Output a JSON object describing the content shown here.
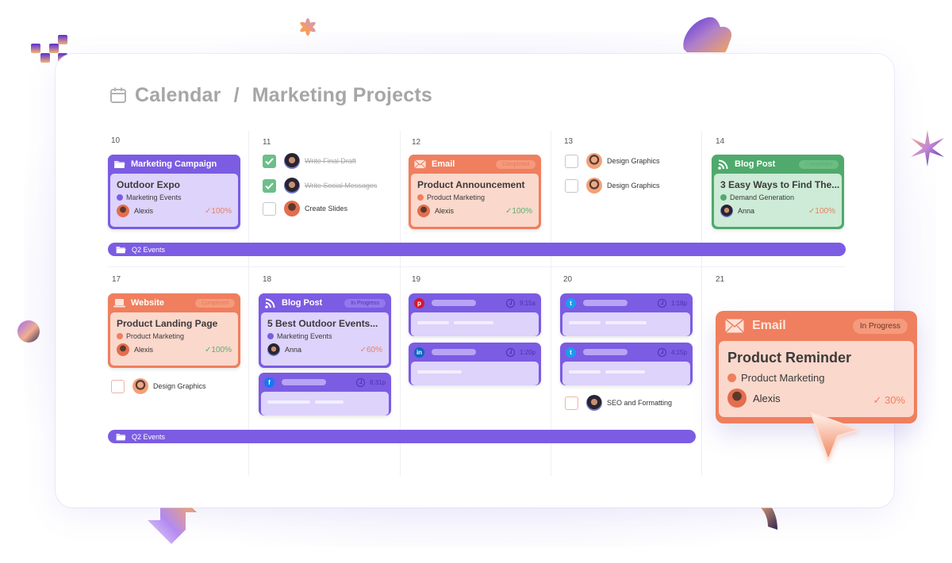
{
  "header": {
    "icon": "calendar-icon",
    "crumb1": "Calendar",
    "separator": "/",
    "crumb2": "Marketing Projects"
  },
  "days": {
    "d10": "10",
    "d11": "11",
    "d12": "12",
    "d13": "13",
    "d14": "14",
    "d17": "17",
    "d18": "18",
    "d19": "19",
    "d20": "20",
    "d21": "21"
  },
  "cards": {
    "outdoor_expo": {
      "type_label": "Marketing Campaign",
      "type_icon": "folder-icon",
      "title": "Outdoor Expo",
      "tag": "Marketing Events",
      "assignee": "Alexis",
      "progress": "100%",
      "color": "#7b5ce3"
    },
    "product_announcement": {
      "type_label": "Email",
      "type_icon": "envelope-icon",
      "status": "Completed",
      "title": "Product Announcement",
      "tag": "Product Marketing",
      "assignee": "Alexis",
      "progress": "100%",
      "color": "#ef7f5e"
    },
    "easy_ways": {
      "type_label": "Blog Post",
      "type_icon": "rss-icon",
      "status": "Completed",
      "title": "3 Easy Ways to Find The...",
      "tag": "Demand Generation",
      "assignee": "Anna",
      "progress": "100%",
      "color": "#4faa6c"
    },
    "landing_page": {
      "type_label": "Website",
      "type_icon": "laptop-icon",
      "status": "Completed",
      "title": "Product Landing Page",
      "tag": "Product Marketing",
      "assignee": "Alexis",
      "progress": "100%",
      "color": "#ef7f5e"
    },
    "outdoor_events": {
      "type_label": "Blog Post",
      "type_icon": "rss-icon",
      "status": "In Progress",
      "title": "5 Best Outdoor Events...",
      "tag": "Marketing Events",
      "assignee": "Anna",
      "progress": "60%",
      "color": "#7b5ce3"
    }
  },
  "popup": {
    "type_label": "Email",
    "type_icon": "envelope-icon",
    "status": "In Progress",
    "title": "Product Reminder",
    "tag": "Product Marketing",
    "assignee": "Alexis",
    "progress": "30%",
    "color": "#ef7f5e"
  },
  "tasks": {
    "write_final_draft": {
      "label": "Write Final Draft",
      "done": true,
      "assignee": "Anna"
    },
    "write_social": {
      "label": "Write Social Messages",
      "done": true,
      "assignee": "Anna"
    },
    "create_slides": {
      "label": "Create Slides",
      "done": false,
      "assignee": "Alexis"
    },
    "design_graphics_1": {
      "label": "Design Graphics",
      "done": false
    },
    "design_graphics_2": {
      "label": "Design Graphics",
      "done": false
    },
    "design_graphics_3": {
      "label": "Design Graphics",
      "done": false
    },
    "seo": {
      "label": "SEO and Formatting",
      "done": false,
      "assignee": "Anna"
    }
  },
  "bars": {
    "week1": {
      "label": "Q2 Events",
      "icon": "folder-icon"
    },
    "week2": {
      "label": "Q2 Events",
      "icon": "folder-icon"
    }
  },
  "social_posts": {
    "facebook": {
      "network": "facebook",
      "glyph": "f",
      "time": "8:31p",
      "color": "#1877f2"
    },
    "pinterest": {
      "network": "pinterest",
      "glyph": "p",
      "time": "9:15a",
      "color": "#d6182b"
    },
    "linkedin": {
      "network": "linkedin",
      "glyph": "in",
      "time": "1:20p",
      "color": "#0a66c2"
    },
    "twitter1": {
      "network": "twitter",
      "glyph": "t",
      "time": "1:18p",
      "color": "#1d9bf0"
    },
    "twitter2": {
      "network": "twitter",
      "glyph": "t",
      "time": "4:15p",
      "color": "#1d9bf0"
    }
  },
  "check_mark": "✓"
}
